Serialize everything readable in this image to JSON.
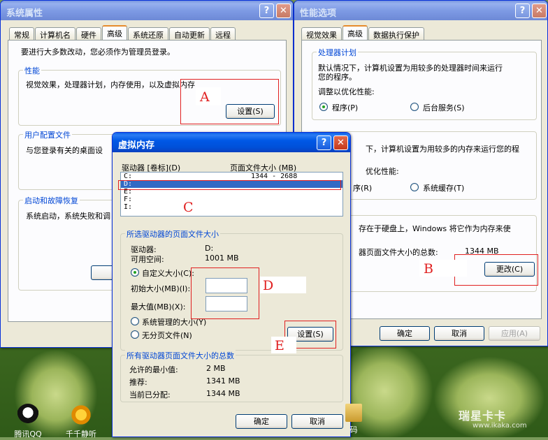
{
  "sys_props": {
    "title": "系统属性",
    "tabs": [
      "常规",
      "计算机名",
      "硬件",
      "高级",
      "系统还原",
      "自动更新",
      "远程"
    ],
    "admin_note": "要进行大多数改动，您必须作为管理员登录。",
    "performance": {
      "title": "性能",
      "desc": "视觉效果，处理器计划，内存使用，以及虚拟内存",
      "settings": "设置(S)"
    },
    "user_profiles": {
      "title": "用户配置文件",
      "desc": "与您登录有关的桌面设"
    },
    "startup": {
      "title": "启动和故障恢复",
      "desc": "系统启动，系统失败和调"
    }
  },
  "perf_options": {
    "title": "性能选项",
    "tabs": [
      "视觉效果",
      "高级",
      "数据执行保护"
    ],
    "processor": {
      "title": "处理器计划",
      "desc1": "默认情况下，计算机设置为用较多的处理器时间来运行",
      "desc2": "您的程序。",
      "adjust": "调整以优化性能:",
      "opt1": "程序(P)",
      "opt2": "后台服务(S)"
    },
    "memory": {
      "title": "内存使用",
      "desc": "下，计算机设置为用较多的内存来运行您的程",
      "adjust": "优化性能:",
      "opt1": "序(R)",
      "opt2": "系统缓存(T)"
    },
    "virtual": {
      "desc1": "存在于硬盘上，Windows 将它作为内存来使",
      "desc2": "器页面文件大小的总数:",
      "total": "1344 MB",
      "change": "更改(C)"
    },
    "ok": "确定",
    "cancel": "取消",
    "apply": "应用(A)"
  },
  "vm": {
    "title": "虚拟内存",
    "header_drive": "驱动器 [卷标](D)",
    "header_size": "页面文件大小 (MB)",
    "drives": [
      {
        "name": "C:",
        "size": "1344 - 2688"
      },
      {
        "name": "D:",
        "size": ""
      },
      {
        "name": "E:",
        "size": ""
      },
      {
        "name": "F:",
        "size": ""
      },
      {
        "name": "I:",
        "size": ""
      }
    ],
    "selected": {
      "title": "所选驱动器的页面文件大小",
      "drive_label": "驱动器:",
      "drive_value": "D:",
      "space_label": "可用空间:",
      "space_value": "1001 MB",
      "custom": "自定义大小(C):",
      "initial": "初始大小(MB)(I):",
      "max": "最大值(MB)(X):",
      "system": "系统管理的大小(Y)",
      "none": "无分页文件(N)",
      "set": "设置(S)"
    },
    "total": {
      "title": "所有驱动器页面文件大小的总数",
      "min_label": "允许的最小值:",
      "min_value": "2 MB",
      "rec_label": "推荐:",
      "rec_value": "1341 MB",
      "cur_label": "当前已分配:",
      "cur_value": "1344 MB"
    },
    "ok": "确定",
    "cancel": "取消"
  },
  "annotations": {
    "a": "A",
    "b": "B",
    "c": "C",
    "d": "D",
    "e": "E"
  },
  "desktop": {
    "qq": "腾讯QQ",
    "ttplayer": "千千静听",
    "partial": "码",
    "watermark": "瑞星卡卡",
    "watermark_url": "www.ikaka.com"
  }
}
